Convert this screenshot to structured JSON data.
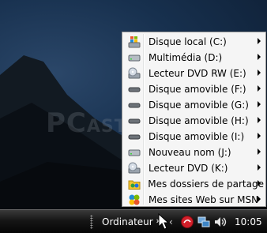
{
  "menu": {
    "items": [
      {
        "label": "Disque local (C:)",
        "icon": "windows-drive-icon",
        "submenu": true
      },
      {
        "label": "Multimédia (D:)",
        "icon": "hard-drive-icon",
        "submenu": true
      },
      {
        "label": "Lecteur DVD RW (E:)",
        "icon": "dvd-rw-drive-icon",
        "submenu": true
      },
      {
        "label": "Disque amovible (F:)",
        "icon": "removable-drive-icon",
        "submenu": true
      },
      {
        "label": "Disque amovible (G:)",
        "icon": "removable-drive-icon",
        "submenu": true
      },
      {
        "label": "Disque amovible (H:)",
        "icon": "removable-drive-icon",
        "submenu": true
      },
      {
        "label": "Disque amovible (I:)",
        "icon": "removable-drive-icon",
        "submenu": true
      },
      {
        "label": "Nouveau nom (J:)",
        "icon": "hard-drive-icon",
        "submenu": true
      },
      {
        "label": "Lecteur DVD (K:)",
        "icon": "dvd-drive-icon",
        "submenu": true
      },
      {
        "label": "Mes dossiers de partage",
        "icon": "shared-folders-icon",
        "submenu": true
      },
      {
        "label": "Mes sites Web sur MSN",
        "icon": "msn-sites-icon",
        "submenu": true
      }
    ]
  },
  "taskbar": {
    "toolbar_label": "Ordinateur",
    "chevron": "»",
    "collapse": "‹",
    "clock": "10:05"
  },
  "watermark": {
    "text": "PC",
    "small": "AST"
  }
}
